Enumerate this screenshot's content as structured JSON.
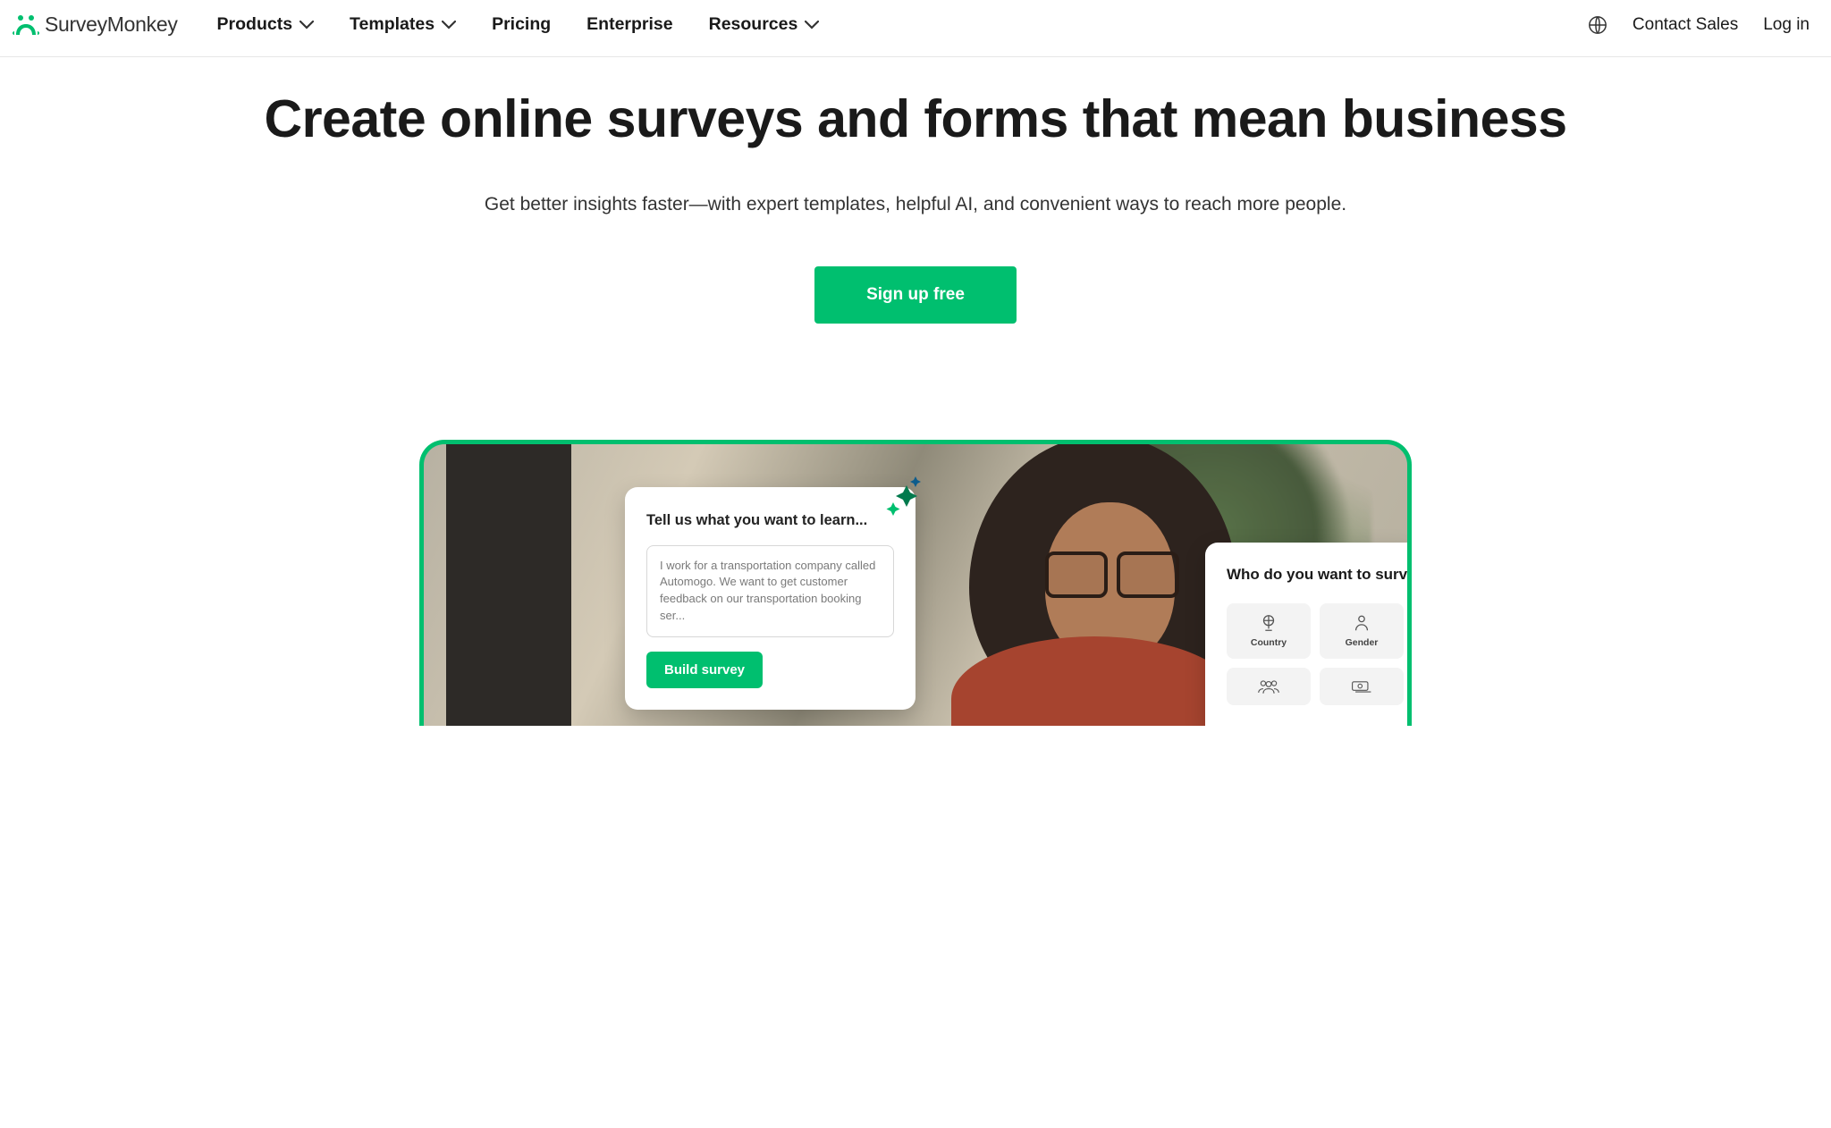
{
  "brand": "SurveyMonkey",
  "nav": {
    "items": [
      {
        "label": "Products",
        "has_submenu": true
      },
      {
        "label": "Templates",
        "has_submenu": true
      },
      {
        "label": "Pricing",
        "has_submenu": false
      },
      {
        "label": "Enterprise",
        "has_submenu": false
      },
      {
        "label": "Resources",
        "has_submenu": true
      }
    ],
    "contact_sales": "Contact Sales",
    "log_in": "Log in"
  },
  "hero": {
    "headline": "Create online surveys and forms that mean business",
    "subhead": "Get better insights faster—with expert templates, helpful AI, and convenient ways to reach more people.",
    "cta": "Sign up free"
  },
  "learn_card": {
    "title": "Tell us what you want to learn...",
    "sample_text": "I work for a transportation company called Automogo. We want to get customer feedback on our transportation booking ser...",
    "button": "Build survey"
  },
  "survey_card": {
    "title": "Who do you want to surve",
    "tiles": [
      {
        "icon": "globe",
        "label": "Country"
      },
      {
        "icon": "person",
        "label": "Gender"
      },
      {
        "icon": "group",
        "label": ""
      },
      {
        "icon": "money",
        "label": ""
      }
    ]
  },
  "colors": {
    "brand_green": "#00BF6F"
  }
}
